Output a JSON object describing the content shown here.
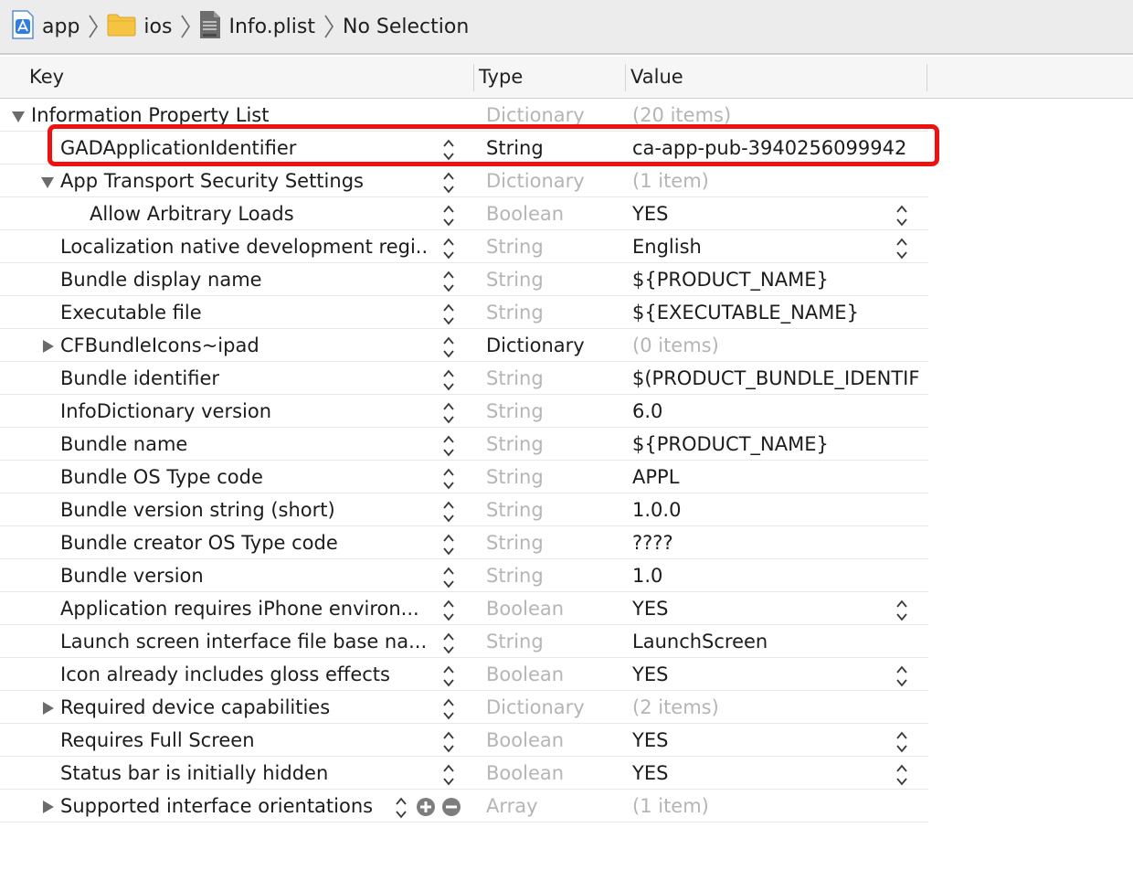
{
  "breadcrumbs": [
    {
      "label": "app",
      "icon": "xcode-project-icon"
    },
    {
      "label": "ios",
      "icon": "folder-icon"
    },
    {
      "label": "Info.plist",
      "icon": "plist-file-icon"
    },
    {
      "label": "No Selection",
      "icon": ""
    }
  ],
  "columns": {
    "key": "Key",
    "type": "Type",
    "value": "Value"
  },
  "rows": [
    {
      "key": "Information Property List",
      "type": "Dictionary",
      "value": "(20 items)",
      "disclosure": "expanded",
      "indent": 0,
      "type_dim": true,
      "value_dim": true,
      "has_stepper": false,
      "has_value_stepper": false
    },
    {
      "key": "GADApplicationIdentifier",
      "type": "String",
      "value": "ca-app-pub-3940256099942",
      "disclosure": "none",
      "indent": 1,
      "type_dim": false,
      "value_dim": false,
      "has_stepper": true,
      "has_value_stepper": false
    },
    {
      "key": "App Transport Security Settings",
      "type": "Dictionary",
      "value": "(1 item)",
      "disclosure": "expanded",
      "indent": 1,
      "type_dim": true,
      "value_dim": true,
      "has_stepper": true,
      "has_value_stepper": false
    },
    {
      "key": "Allow Arbitrary Loads",
      "type": "Boolean",
      "value": "YES",
      "disclosure": "none",
      "indent": 2,
      "type_dim": true,
      "value_dim": false,
      "has_stepper": true,
      "has_value_stepper": true
    },
    {
      "key": "Localization native development regi...",
      "type": "String",
      "value": "English",
      "disclosure": "none",
      "indent": 1,
      "type_dim": true,
      "value_dim": false,
      "has_stepper": true,
      "has_value_stepper": true
    },
    {
      "key": "Bundle display name",
      "type": "String",
      "value": "${PRODUCT_NAME}",
      "disclosure": "none",
      "indent": 1,
      "type_dim": true,
      "value_dim": false,
      "has_stepper": true,
      "has_value_stepper": false
    },
    {
      "key": "Executable file",
      "type": "String",
      "value": "${EXECUTABLE_NAME}",
      "disclosure": "none",
      "indent": 1,
      "type_dim": true,
      "value_dim": false,
      "has_stepper": true,
      "has_value_stepper": false
    },
    {
      "key": "CFBundleIcons~ipad",
      "type": "Dictionary",
      "value": "(0 items)",
      "disclosure": "collapsed",
      "indent": 1,
      "type_dim": false,
      "value_dim": true,
      "has_stepper": true,
      "has_value_stepper": false
    },
    {
      "key": "Bundle identifier",
      "type": "String",
      "value": "$(PRODUCT_BUNDLE_IDENTIF",
      "disclosure": "none",
      "indent": 1,
      "type_dim": true,
      "value_dim": false,
      "has_stepper": true,
      "has_value_stepper": false
    },
    {
      "key": "InfoDictionary version",
      "type": "String",
      "value": "6.0",
      "disclosure": "none",
      "indent": 1,
      "type_dim": true,
      "value_dim": false,
      "has_stepper": true,
      "has_value_stepper": false
    },
    {
      "key": "Bundle name",
      "type": "String",
      "value": "${PRODUCT_NAME}",
      "disclosure": "none",
      "indent": 1,
      "type_dim": true,
      "value_dim": false,
      "has_stepper": true,
      "has_value_stepper": false
    },
    {
      "key": "Bundle OS Type code",
      "type": "String",
      "value": "APPL",
      "disclosure": "none",
      "indent": 1,
      "type_dim": true,
      "value_dim": false,
      "has_stepper": true,
      "has_value_stepper": false
    },
    {
      "key": "Bundle version string (short)",
      "type": "String",
      "value": "1.0.0",
      "disclosure": "none",
      "indent": 1,
      "type_dim": true,
      "value_dim": false,
      "has_stepper": true,
      "has_value_stepper": false
    },
    {
      "key": "Bundle creator OS Type code",
      "type": "String",
      "value": "????",
      "disclosure": "none",
      "indent": 1,
      "type_dim": true,
      "value_dim": false,
      "has_stepper": true,
      "has_value_stepper": false
    },
    {
      "key": "Bundle version",
      "type": "String",
      "value": "1.0",
      "disclosure": "none",
      "indent": 1,
      "type_dim": true,
      "value_dim": false,
      "has_stepper": true,
      "has_value_stepper": false
    },
    {
      "key": "Application requires iPhone environ...",
      "type": "Boolean",
      "value": "YES",
      "disclosure": "none",
      "indent": 1,
      "type_dim": true,
      "value_dim": false,
      "has_stepper": true,
      "has_value_stepper": true
    },
    {
      "key": "Launch screen interface file base na...",
      "type": "String",
      "value": "LaunchScreen",
      "disclosure": "none",
      "indent": 1,
      "type_dim": true,
      "value_dim": false,
      "has_stepper": true,
      "has_value_stepper": false
    },
    {
      "key": "Icon already includes gloss effects",
      "type": "Boolean",
      "value": "YES",
      "disclosure": "none",
      "indent": 1,
      "type_dim": true,
      "value_dim": false,
      "has_stepper": true,
      "has_value_stepper": true
    },
    {
      "key": "Required device capabilities",
      "type": "Dictionary",
      "value": "(2 items)",
      "disclosure": "collapsed",
      "indent": 1,
      "type_dim": true,
      "value_dim": true,
      "has_stepper": true,
      "has_value_stepper": false
    },
    {
      "key": "Requires Full Screen",
      "type": "Boolean",
      "value": "YES",
      "disclosure": "none",
      "indent": 1,
      "type_dim": true,
      "value_dim": false,
      "has_stepper": true,
      "has_value_stepper": true
    },
    {
      "key": "Status bar is initially hidden",
      "type": "Boolean",
      "value": "YES",
      "disclosure": "none",
      "indent": 1,
      "type_dim": true,
      "value_dim": false,
      "has_stepper": true,
      "has_value_stepper": true
    },
    {
      "key": "Supported interface orientations",
      "type": "Array",
      "value": "(1 item)",
      "disclosure": "collapsed",
      "indent": 1,
      "type_dim": true,
      "value_dim": true,
      "has_stepper": true,
      "has_value_stepper": false,
      "has_add_remove": true
    }
  ],
  "highlight_color": "#ee1111",
  "dim_text_color": "#b5b5b5"
}
